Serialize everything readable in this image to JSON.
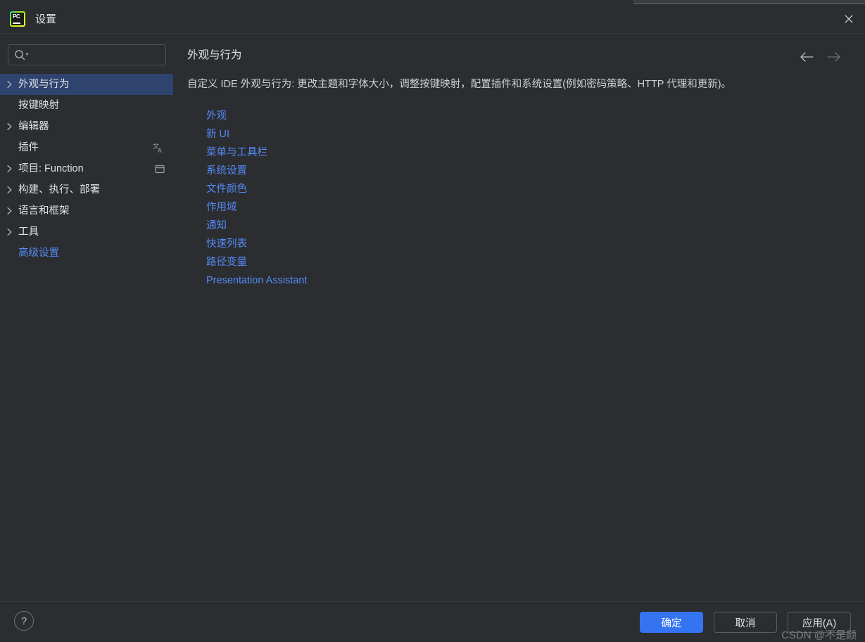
{
  "window": {
    "title": "设置",
    "app_icon": "pycharm-logo-icon",
    "close_icon": "close-icon"
  },
  "search": {
    "value": "",
    "placeholder": "",
    "icon": "search-icon"
  },
  "sidebar": {
    "items": [
      {
        "label": "外观与行为",
        "expandable": true,
        "selected": true,
        "link": false,
        "trailing_icon": ""
      },
      {
        "label": "按键映射",
        "expandable": false,
        "selected": false,
        "link": false,
        "trailing_icon": ""
      },
      {
        "label": "编辑器",
        "expandable": true,
        "selected": false,
        "link": false,
        "trailing_icon": ""
      },
      {
        "label": "插件",
        "expandable": false,
        "selected": false,
        "link": false,
        "trailing_icon": "translate-icon"
      },
      {
        "label": "项目: Function",
        "expandable": true,
        "selected": false,
        "link": false,
        "trailing_icon": "project-panel-icon"
      },
      {
        "label": "构建、执行、部署",
        "expandable": true,
        "selected": false,
        "link": false,
        "trailing_icon": ""
      },
      {
        "label": "语言和框架",
        "expandable": true,
        "selected": false,
        "link": false,
        "trailing_icon": ""
      },
      {
        "label": "工具",
        "expandable": true,
        "selected": false,
        "link": false,
        "trailing_icon": ""
      },
      {
        "label": "高级设置",
        "expandable": false,
        "selected": false,
        "link": true,
        "trailing_icon": ""
      }
    ]
  },
  "main": {
    "title": "外观与行为",
    "description": "自定义 IDE 外观与行为: 更改主题和字体大小，调整按键映射，配置插件和系统设置(例如密码策略、HTTP 代理和更新)。",
    "back_icon": "arrow-left-icon",
    "forward_icon": "arrow-right-icon",
    "links": [
      "外观",
      "新 UI",
      "菜单与工具栏",
      "系统设置",
      "文件颜色",
      "作用域",
      "通知",
      "快速列表",
      "路径变量",
      "Presentation Assistant"
    ]
  },
  "footer": {
    "help_label": "?",
    "ok_label": "确定",
    "cancel_label": "取消",
    "apply_label": "应用(A)",
    "watermark": "CSDN @不是颜"
  },
  "colors": {
    "background": "#2b2d30",
    "selection": "#2e436e",
    "link": "#548af7",
    "primary_button": "#3574f0",
    "text": "#dfe1e5",
    "border": "#393b40"
  }
}
